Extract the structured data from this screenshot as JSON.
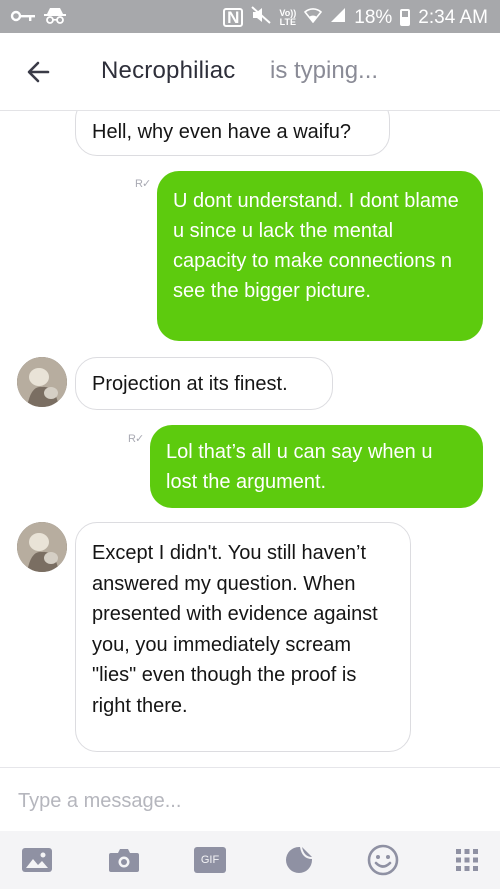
{
  "status_bar": {
    "nfc": "N",
    "volte_line1": "Vo))",
    "volte_line2": "LTE",
    "battery": "18%",
    "time": "2:34 AM"
  },
  "header": {
    "contact_name": "Necrophiliac",
    "status": "is typing..."
  },
  "messages": [
    {
      "sender": "them",
      "text": "Hell, why even have a waifu?",
      "avatar": false
    },
    {
      "sender": "me",
      "text": "U dont understand. I dont blame u since u lack the mental capacity to make connections n see the bigger picture.",
      "read_marker": "R"
    },
    {
      "sender": "them",
      "text": "Projection at its finest.",
      "avatar": true
    },
    {
      "sender": "me",
      "text": "Lol that’s all u can say when u lost the argument.",
      "read_marker": "R"
    },
    {
      "sender": "them",
      "text": "Except I didn't. You still haven’t answered my question. When presented with evidence against you, you immediately scream \"lies\" even though the proof is right there.",
      "avatar": true
    }
  ],
  "composer": {
    "placeholder": "Type a message..."
  },
  "toolbar": {
    "gif_label": "GIF",
    "items": [
      "gallery-icon",
      "camera-icon",
      "gif-icon",
      "sticker-icon",
      "smiley-icon",
      "more-grid-icon"
    ]
  },
  "colors": {
    "outgoing_bubble": "#5dcb0e",
    "status_bar": "#a7a8ab",
    "accent_icon": "#8f91a3"
  }
}
